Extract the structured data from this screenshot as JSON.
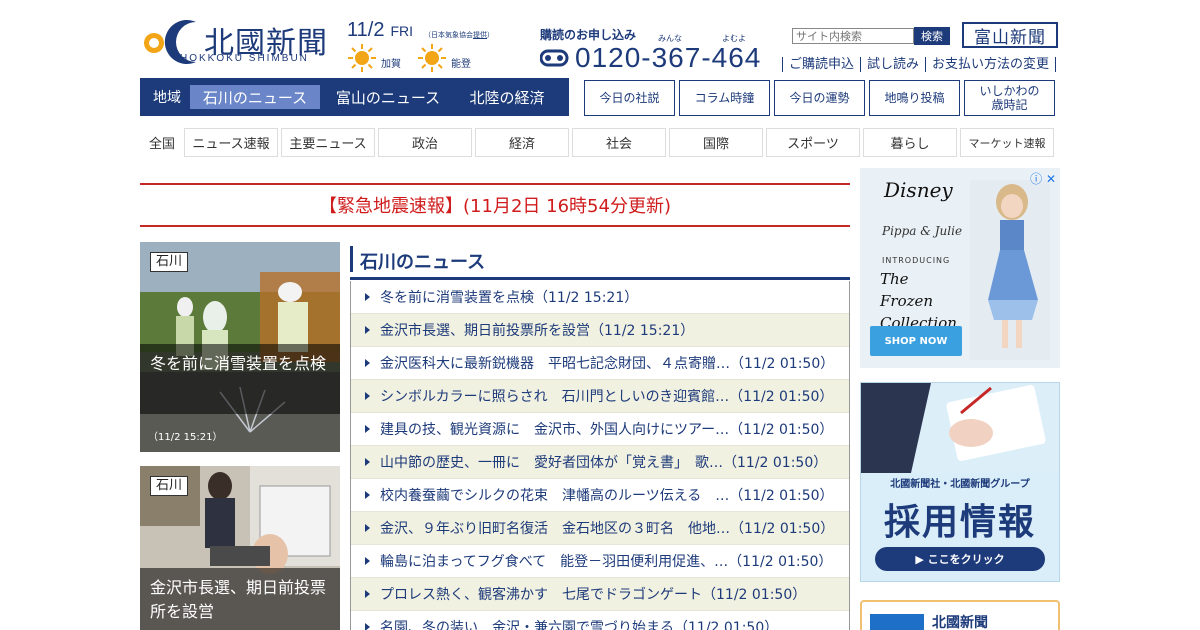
{
  "header": {
    "logo_title": "北國新聞",
    "logo_sub": "HOKKOKU SHIMBUN",
    "date": "11/2",
    "weekday": "FRI",
    "source_note": "（日本気象協会",
    "source_link": "提供",
    "source_close": "）",
    "weather": [
      {
        "label": "加賀",
        "icon": "sun-icon"
      },
      {
        "label": "能登",
        "icon": "sun-icon"
      }
    ],
    "subscribe_title": "購読のお申し込み",
    "ruby_minna": "みんな",
    "ruby_yomu": "よむよ",
    "phone": "0120-367-464",
    "search_placeholder": "サイト内検索",
    "search_button": "検索",
    "toyama_button": "富山新聞",
    "links": [
      "ご購読申込",
      "試し読み",
      "お支払い方法の変更"
    ]
  },
  "region_nav": {
    "label": "地域",
    "tabs": [
      {
        "label": "石川のニュース",
        "active": true
      },
      {
        "label": "富山のニュース",
        "active": false
      },
      {
        "label": "北陸の経済",
        "active": false
      }
    ]
  },
  "quick_buttons": [
    "今日の社説",
    "コラム時鐘",
    "今日の運勢",
    "地鳴り投稿",
    "いしかわの\n歳時記"
  ],
  "category_nav": {
    "label": "全国",
    "items": [
      "ニュース速報",
      "主要ニュース",
      "政治",
      "経済",
      "社会",
      "国際",
      "スポーツ",
      "暮らし",
      "マーケット速報"
    ]
  },
  "breaking": "【緊急地震速報】(11月2日 16時54分更新)",
  "photos": [
    {
      "tag": "石川",
      "caption": "冬を前に消雪装置を点検",
      "time": "（11/2 15:21）"
    },
    {
      "tag": "石川",
      "caption": "金沢市長選、期日前投票所を設営",
      "time": ""
    }
  ],
  "news": {
    "title": "石川のニュース",
    "items": [
      "冬を前に消雪装置を点検（11/2 15:21）",
      "金沢市長選、期日前投票所を設営（11/2 15:21）",
      "金沢医科大に最新鋭機器　平昭七記念財団、４点寄贈…（11/2 01:50）",
      "シンボルカラーに照らされ　石川門としいのき迎賓館…（11/2 01:50）",
      "建具の技、観光資源に　金沢市、外国人向けにツアー…（11/2 01:50）",
      "山中節の歴史、一冊に　愛好者団体が「覚え書」　歌…（11/2 01:50）",
      "校内養蚕繭でシルクの花束　津幡高のルーツ伝える　…（11/2 01:50）",
      "金沢、９年ぶり旧町名復活　金石地区の３町名　他地…（11/2 01:50）",
      "輪島に泊まってフグ食べて　能登－羽田便利用促進、…（11/2 01:50）",
      "プロレス熱く、観客沸かす　七尾でドラゴンゲート（11/2 01:50）",
      "名園、冬の装い　金沢・兼六園で雪づり始まる（11/2 01:50）"
    ]
  },
  "ads": {
    "ad1": {
      "info": "ⓘ ✕",
      "brand": "Disney",
      "sub_brand": "Pippa & Julie",
      "intro": "INTRODUCING",
      "headline": "The Frozen Collection",
      "cta": "SHOP NOW"
    },
    "ad2": {
      "corp": "北國新聞社・北國新聞グループ",
      "headline": "採用情報",
      "cta": "▶ ここをクリック"
    },
    "ad3": {
      "name": "北國新聞"
    }
  },
  "colors": {
    "brand_navy": "#1d3a7a",
    "active_tab": "#6a86c8",
    "breaking_red": "#d01c1c",
    "stripe": "#f1f1e1"
  }
}
